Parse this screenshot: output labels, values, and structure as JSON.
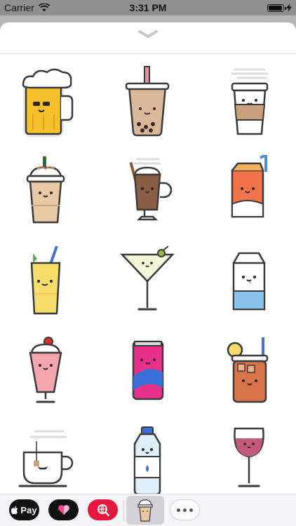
{
  "status_bar": {
    "carrier": "Carrier",
    "time": "3:31 PM",
    "battery_level": 0.95
  },
  "sheet": {
    "handle_icon": "chevron-down-icon"
  },
  "stickers": [
    {
      "name": "beer-mug-sticker"
    },
    {
      "name": "bubble-tea-sticker"
    },
    {
      "name": "coffee-cup-sticker"
    },
    {
      "name": "frappuccino-sticker"
    },
    {
      "name": "hot-chocolate-sticker"
    },
    {
      "name": "juice-box-sticker"
    },
    {
      "name": "lemonade-sticker"
    },
    {
      "name": "martini-sticker"
    },
    {
      "name": "milk-carton-sticker"
    },
    {
      "name": "milkshake-sticker"
    },
    {
      "name": "soda-can-sticker"
    },
    {
      "name": "iced-tea-jar-sticker"
    },
    {
      "name": "tea-cup-sticker"
    },
    {
      "name": "water-bottle-sticker"
    },
    {
      "name": "wine-glass-sticker"
    }
  ],
  "app_drawer": {
    "applepay_label": "Pay",
    "icons": [
      "apple-icon",
      "heart-icon",
      "globe-search-icon",
      "frappuccino-app-icon",
      "more-icon"
    ]
  }
}
